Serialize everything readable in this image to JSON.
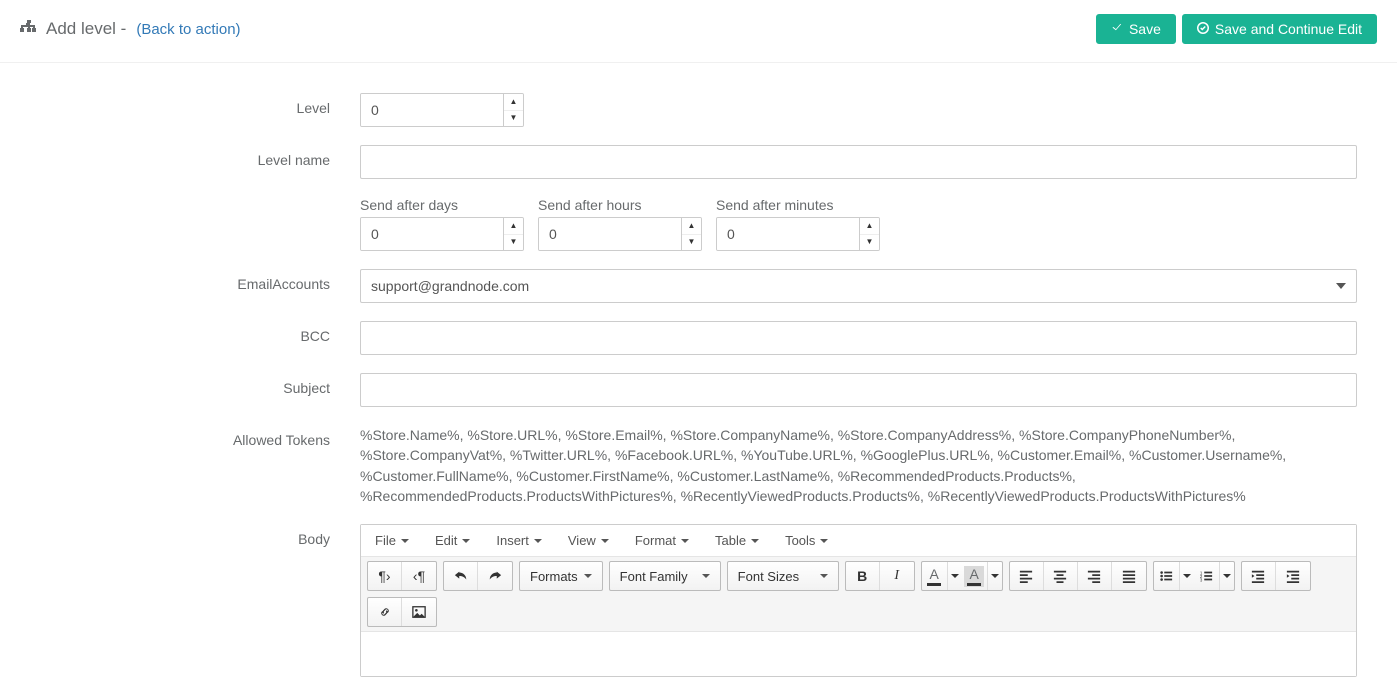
{
  "header": {
    "title": "Add level -",
    "back_link": "(Back to action)",
    "save_label": "Save",
    "save_continue_label": "Save and Continue Edit"
  },
  "labels": {
    "level": "Level",
    "level_name": "Level name",
    "send_after_days": "Send after days",
    "send_after_hours": "Send after hours",
    "send_after_minutes": "Send after minutes",
    "email_accounts": "EmailAccounts",
    "bcc": "BCC",
    "subject": "Subject",
    "allowed_tokens": "Allowed Tokens",
    "body": "Body"
  },
  "form": {
    "level": "0",
    "level_name": "",
    "send_after_days": "0",
    "send_after_hours": "0",
    "send_after_minutes": "0",
    "email_account_selected": "support@grandnode.com",
    "bcc": "",
    "subject": "",
    "allowed_tokens_text": "%Store.Name%, %Store.URL%, %Store.Email%, %Store.CompanyName%, %Store.CompanyAddress%, %Store.CompanyPhoneNumber%, %Store.CompanyVat%, %Twitter.URL%, %Facebook.URL%, %YouTube.URL%, %GooglePlus.URL%, %Customer.Email%, %Customer.Username%, %Customer.FullName%, %Customer.FirstName%, %Customer.LastName%, %RecommendedProducts.Products%, %RecommendedProducts.ProductsWithPictures%, %RecentlyViewedProducts.Products%, %RecentlyViewedProducts.ProductsWithPictures%"
  },
  "editor": {
    "menus": [
      "File",
      "Edit",
      "Insert",
      "View",
      "Format",
      "Table",
      "Tools"
    ],
    "toolbar": {
      "formats": "Formats",
      "font_family": "Font Family",
      "font_sizes": "Font Sizes"
    }
  }
}
